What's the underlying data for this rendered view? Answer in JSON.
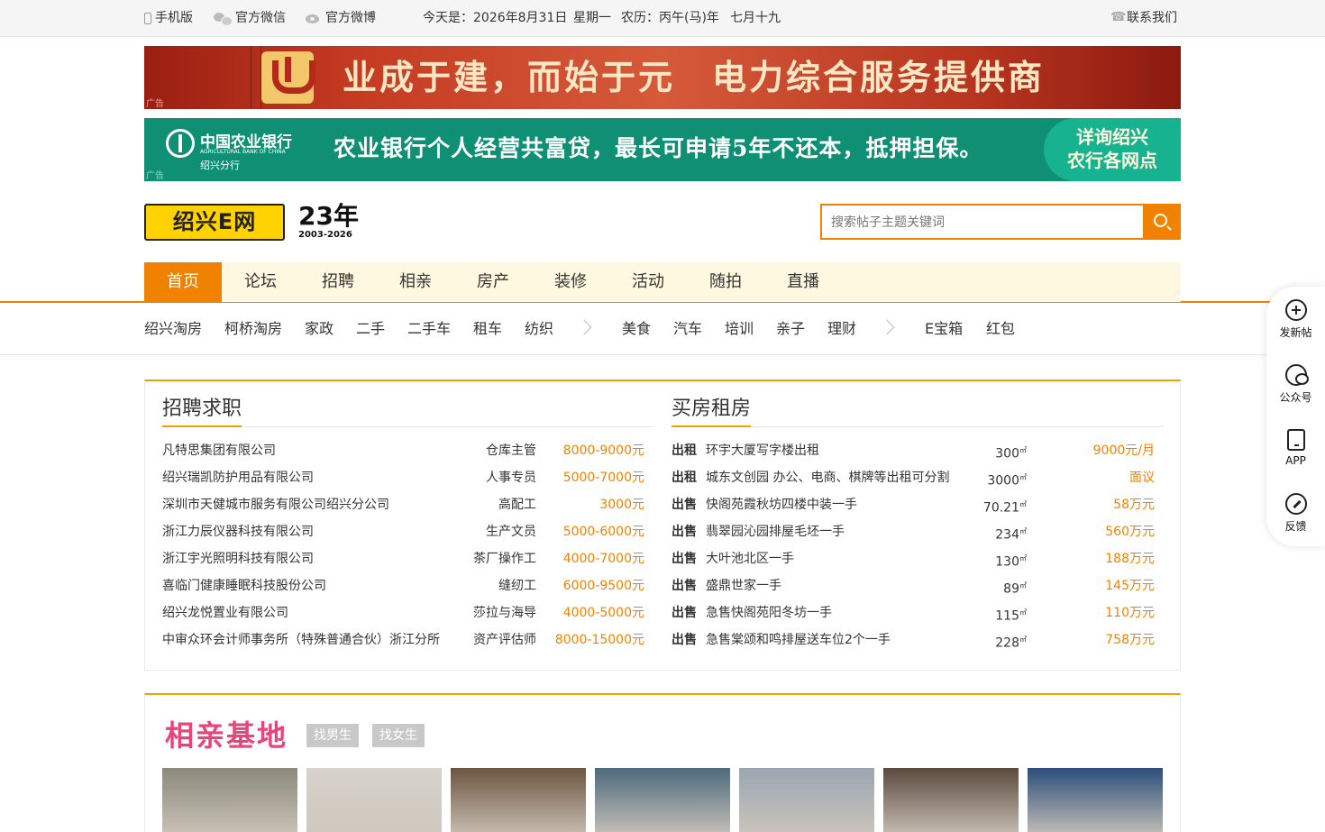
{
  "topbar": {
    "mobile": "手机版",
    "wechat": "官方微信",
    "weibo": "官方微博",
    "date": "今天是：2026年8月31日",
    "weekday": "星期一",
    "lunar": "农历：丙午(马)年",
    "lunar_day": "七月十九",
    "contact": "联系我们"
  },
  "banners": {
    "b1_text": "业成于建，而始于元　电力综合服务提供商",
    "b2_bank": "中国农业银行",
    "b2_bank_en": "AGRICULTURAL BANK OF CHINA",
    "b2_branch": "绍兴分行",
    "b2_text": "农业银行个人经营共富贷，最长可申请5年不还本，抵押担保。",
    "b2_cta_1": "详询绍兴",
    "b2_cta_2": "农行各网点",
    "ad_label": "广告"
  },
  "header": {
    "logo": "绍兴E网",
    "anniv": "23年",
    "anniv_years": "2003-2026",
    "search_placeholder": "搜索帖子主题关键词"
  },
  "mainnav": [
    "首页",
    "论坛",
    "招聘",
    "相亲",
    "房产",
    "装修",
    "活动",
    "随拍",
    "直播"
  ],
  "subnav": {
    "group1": [
      "绍兴淘房",
      "柯桥淘房",
      "家政",
      "二手",
      "二手车",
      "租车",
      "纺织"
    ],
    "group2": [
      "美食",
      "汽车",
      "培训",
      "亲子",
      "理财"
    ],
    "group3": [
      "E宝箱",
      "红包"
    ]
  },
  "jobs": {
    "title": "招聘求职",
    "rows": [
      {
        "company": "凡特思集团有限公司",
        "position": "仓库主管",
        "salary": "8000-9000元"
      },
      {
        "company": "绍兴瑞凯防护用品有限公司",
        "position": "人事专员",
        "salary": "5000-7000元"
      },
      {
        "company": "深圳市天健城市服务有限公司绍兴分公司",
        "position": "高配工",
        "salary": "3000元"
      },
      {
        "company": "浙江力辰仪器科技有限公司",
        "position": "生产文员",
        "salary": "5000-6000元"
      },
      {
        "company": "浙江宇光照明科技有限公司",
        "position": "茶厂操作工",
        "salary": "4000-7000元"
      },
      {
        "company": "喜临门健康睡眠科技股份公司",
        "position": "缝纫工",
        "salary": "6000-9500元"
      },
      {
        "company": "绍兴龙悦置业有限公司",
        "position": "莎拉与海导",
        "salary": "4000-5000元"
      },
      {
        "company": "中审众环会计师事务所（特殊普通合伙）浙江分所",
        "position": "资产评估师",
        "salary": "8000-15000元"
      }
    ]
  },
  "housing": {
    "title": "买房租房",
    "area_unit": "㎡",
    "rows": [
      {
        "type": "出租",
        "name": "环宇大厦写字楼出租",
        "area": "300",
        "price": "9000元/月"
      },
      {
        "type": "出租",
        "name": "城东文创园 办公、电商、棋牌等出租可分割",
        "area": "3000",
        "price": "面议"
      },
      {
        "type": "出售",
        "name": "快阁苑霞秋坊四楼中装一手",
        "area": "70.21",
        "price": "58万元"
      },
      {
        "type": "出售",
        "name": "翡翠园沁园排屋毛坯一手",
        "area": "234",
        "price": "560万元"
      },
      {
        "type": "出售",
        "name": "大叶池北区一手",
        "area": "130",
        "price": "188万元"
      },
      {
        "type": "出售",
        "name": "盛鼎世家一手",
        "area": "89",
        "price": "145万元"
      },
      {
        "type": "出售",
        "name": "急售快阁苑阳冬坊一手",
        "area": "115",
        "price": "110万元"
      },
      {
        "type": "出售",
        "name": "急售棠颂和鸣排屋送车位2个一手",
        "area": "228",
        "price": "758万元"
      }
    ]
  },
  "dating": {
    "title": "相亲基地",
    "find_male": "找男生",
    "find_female": "找女生",
    "photo_colors": [
      "#8a8a7a",
      "#d6d2cc",
      "#6b5540",
      "#4d6a7c",
      "#9aa6b2",
      "#5a4a3e",
      "#2b4e7a"
    ]
  },
  "sidefloat": {
    "post": "发新帖",
    "wechat": "公众号",
    "app": "APP",
    "feedback": "反馈"
  }
}
